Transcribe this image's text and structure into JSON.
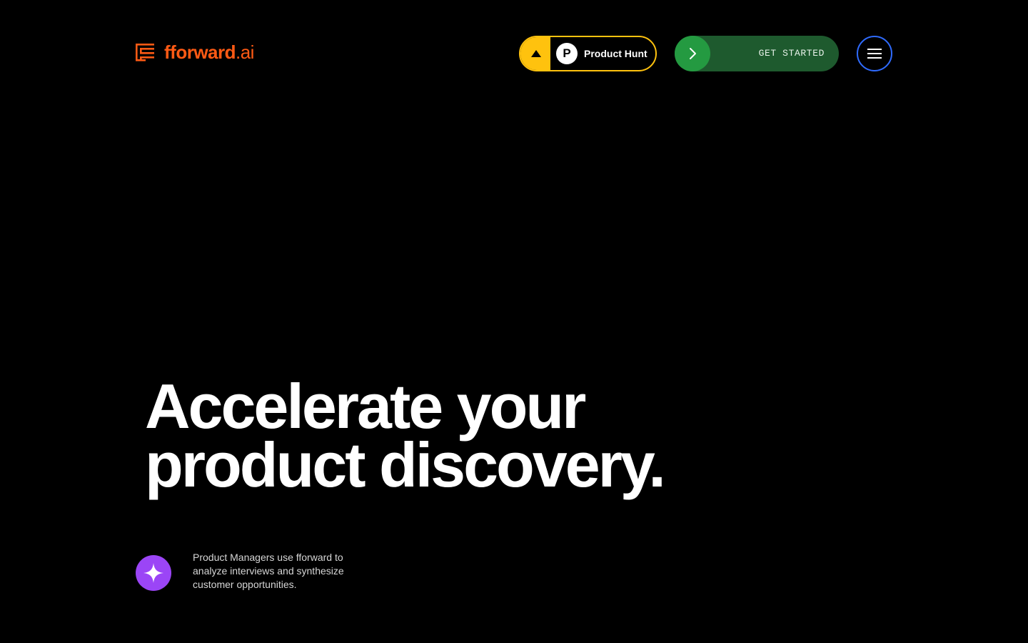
{
  "header": {
    "logo": {
      "brand": "fforward",
      "tld": ".ai",
      "icon": "stacked-bars-logo-icon",
      "color": "#ff5a14"
    },
    "product_hunt": {
      "label": "Product Hunt",
      "badge_letter": "P",
      "icon": "upvote-triangle-icon",
      "accent": "#ffc20e"
    },
    "cta": {
      "label": "GET STARTED",
      "icon": "chevron-right-icon",
      "color": "#1e5a2e",
      "accent": "#249a41"
    },
    "menu": {
      "icon": "hamburger-menu-icon",
      "accent": "#2f6bff"
    }
  },
  "hero": {
    "title_line1": "Accelerate your",
    "title_line2": "product discovery.",
    "subtitle": "Product Managers use fforward to analyze interviews and synthesize customer opportunities.",
    "badge_icon": "sparkle-icon",
    "badge_color": "#9b45f6"
  }
}
